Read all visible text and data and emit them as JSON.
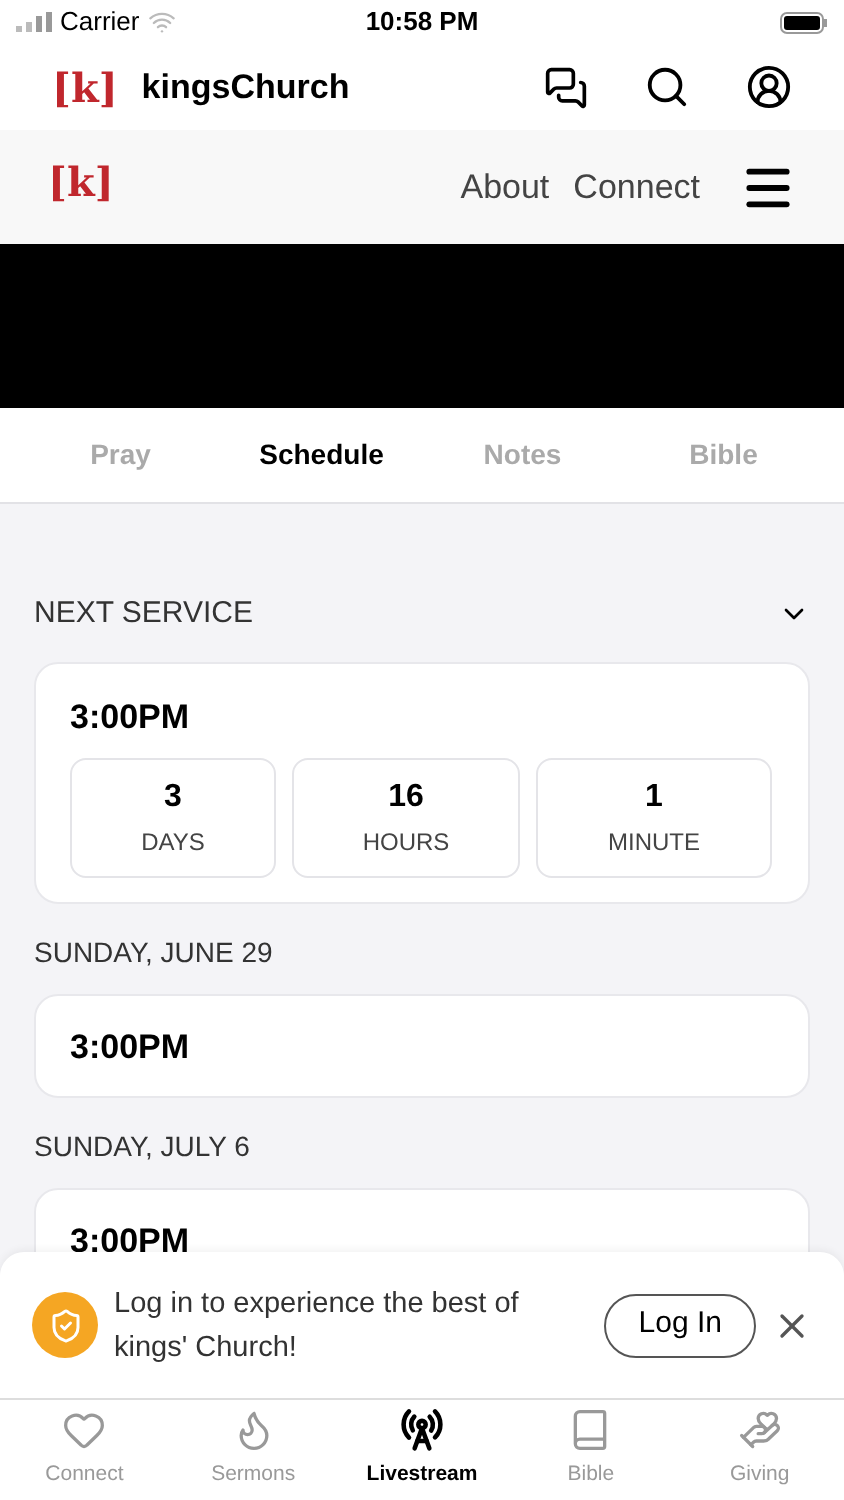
{
  "status_bar": {
    "carrier": "Carrier",
    "time": "10:58 PM"
  },
  "app_header": {
    "logo": "[k]",
    "title": "kingsChurch"
  },
  "site_nav": {
    "logo": "[k]",
    "links": [
      "About",
      "Connect"
    ]
  },
  "video": {
    "kind": "video"
  },
  "tabs": [
    {
      "label": "Pray",
      "selected": false
    },
    {
      "label": "Schedule",
      "selected": true
    },
    {
      "label": "Notes",
      "selected": false
    },
    {
      "label": "Bible",
      "selected": false
    }
  ],
  "next_service": {
    "heading": "NEXT SERVICE",
    "expanded": false,
    "time": "3:00PM",
    "countdown": [
      {
        "value": "3",
        "unit": "DAYS"
      },
      {
        "value": "16",
        "unit": "HOURS"
      },
      {
        "value": "1",
        "unit": "MINUTE"
      }
    ]
  },
  "services": [
    {
      "date": "SUNDAY, JUNE 29",
      "time": "3:00PM"
    },
    {
      "date": "SUNDAY, JULY 6",
      "time": "3:00PM"
    }
  ],
  "login_banner": {
    "message": "Log in to experience the best of kings' Church!",
    "button": "Log In"
  },
  "tab_bar": [
    {
      "label": "Connect",
      "selected": false
    },
    {
      "label": "Sermons",
      "selected": false
    },
    {
      "label": "Livestream",
      "selected": true
    },
    {
      "label": "Bible",
      "selected": false
    },
    {
      "label": "Giving",
      "selected": false
    }
  ]
}
